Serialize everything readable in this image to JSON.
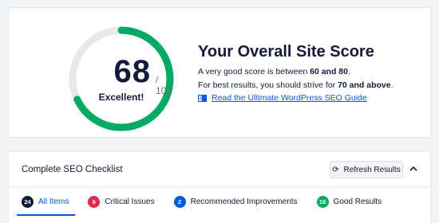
{
  "score": {
    "value": "68",
    "max": "/ 100",
    "label": "Excellent!",
    "fraction": 0.68,
    "color": "#00aa63",
    "track_color": "#e8e8eb"
  },
  "summary": {
    "title": "Your Overall Site Score",
    "line1_prefix": "A very good score is between ",
    "line1_bold": "60 and 80",
    "line1_suffix": ".",
    "line2_prefix": "For best results, you should strive for ",
    "line2_bold": "70 and above",
    "line2_suffix": ".",
    "guide_link": "Read the Ultimate WordPress SEO Guide",
    "guide_icon": "book-icon"
  },
  "checklist": {
    "title": "Complete SEO Checklist",
    "refresh_label": "Refresh Results",
    "refresh_icon": "refresh-icon",
    "collapse_icon": "chevron-up-icon",
    "tabs": [
      {
        "count": "24",
        "label": "All Items",
        "color": "#141b38",
        "active": true
      },
      {
        "count": "6",
        "label": "Critical Issues",
        "color": "#df2a4a",
        "active": false
      },
      {
        "count": "2",
        "label": "Recommended Improvements",
        "color": "#005ae0",
        "active": false
      },
      {
        "count": "16",
        "label": "Good Results",
        "color": "#00aa63",
        "active": false
      }
    ]
  }
}
